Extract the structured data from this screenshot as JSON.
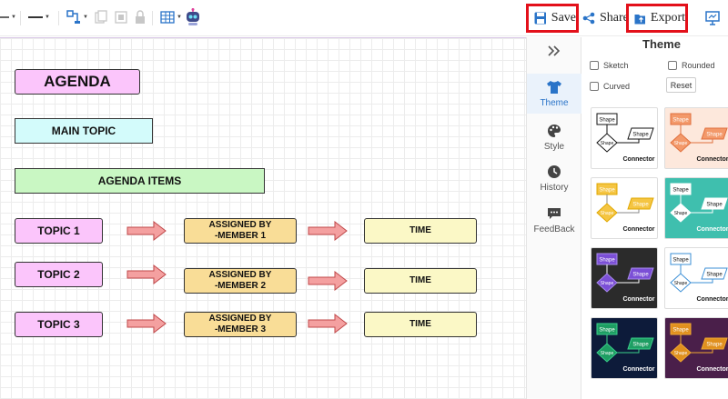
{
  "toolbar": {
    "save_label": "Save",
    "share_label": "Share",
    "export_label": "Export",
    "highlight_color": "#e3101a",
    "accent_color": "#2a74c8"
  },
  "canvas": {
    "agenda_title": "AGENDA",
    "main_topic": "MAIN TOPIC",
    "agenda_items": "AGENDA ITEMS",
    "rows": [
      {
        "topic": "TOPIC 1",
        "assigned": "ASSIGNED BY\n-MEMBER 1",
        "time": "TIME"
      },
      {
        "topic": "TOPIC 2",
        "assigned": "ASSIGNED BY\n-MEMBER 2",
        "time": "TIME"
      },
      {
        "topic": "TOPIC 3",
        "assigned": "ASSIGNED BY\n-MEMBER 3",
        "time": "TIME"
      }
    ]
  },
  "rail": {
    "theme": "Theme",
    "style": "Style",
    "history": "History",
    "feedback": "FeedBack"
  },
  "panel": {
    "title": "Theme",
    "sketch": "Sketch",
    "rounded": "Rounded",
    "curved": "Curved",
    "reset": "Reset",
    "shape_label": "Shape",
    "connector_label": "Connector"
  }
}
